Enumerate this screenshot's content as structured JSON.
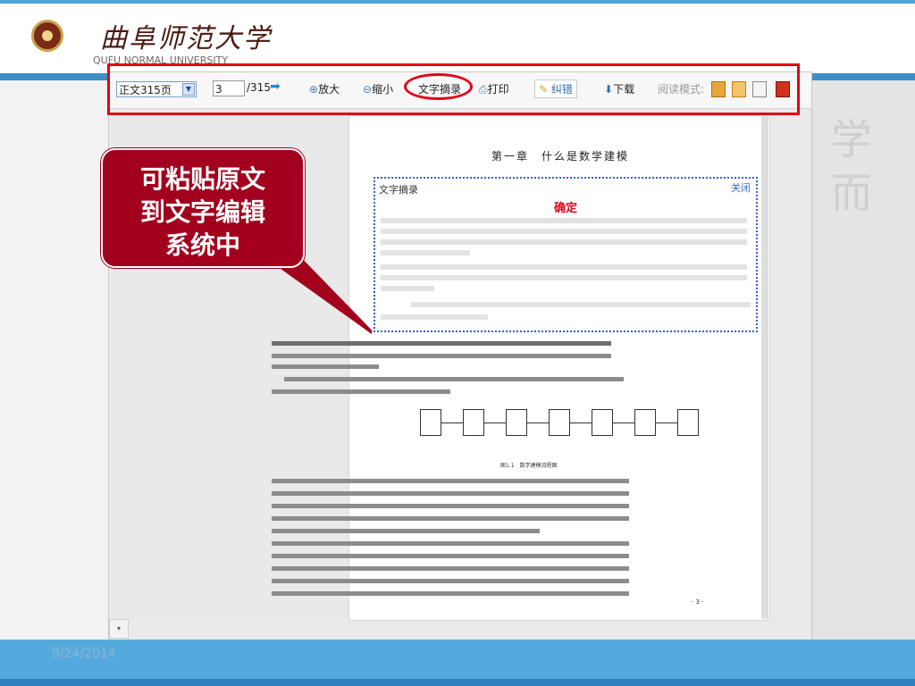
{
  "header": {
    "university_cn": "曲阜师范大学",
    "university_en": "QUFU NORMAL UNIVERSITY"
  },
  "toolbar": {
    "page_select": "正文315页",
    "page_input": "3",
    "page_total": "/315",
    "zoom_in": "放大",
    "zoom_out": "缩小",
    "text_excerpt": "文字摘录",
    "print": "打印",
    "correct": "纠错",
    "download": "下载",
    "read_mode": "阅读模式:"
  },
  "document": {
    "chapter_title": "第一章　什么是数学建模",
    "figure_caption": "图1.1　数学建模流程图",
    "page_number": "· 3 ·"
  },
  "excerpt_panel": {
    "title": "文字摘录",
    "close": "关闭",
    "confirm": "确定"
  },
  "callout": {
    "lines": [
      "可粘贴原文",
      "到文字编辑",
      "系统中"
    ]
  },
  "footer": {
    "date": "9/24/2014"
  },
  "colors": {
    "highlight_red": "#e2001a",
    "callout_red": "#a2001d",
    "band_blue": "#55aadd"
  }
}
